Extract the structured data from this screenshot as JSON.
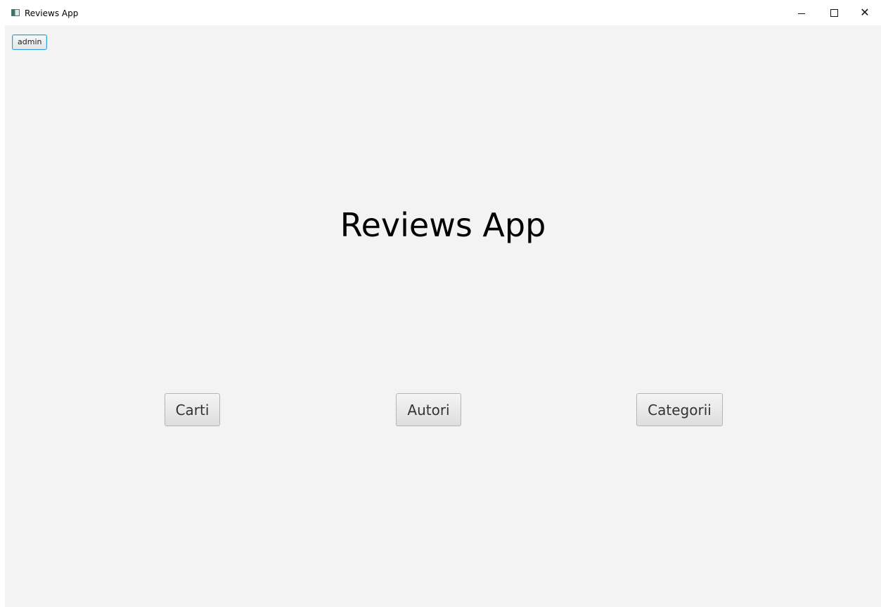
{
  "window": {
    "title": "Reviews App",
    "controls": {
      "minimize_glyph": "–",
      "maximize_glyph": "□",
      "close_glyph": "✕"
    }
  },
  "header": {
    "user_label": "admin"
  },
  "main": {
    "title": "Reviews App",
    "buttons": [
      {
        "label": "Carti"
      },
      {
        "label": "Autori"
      },
      {
        "label": "Categorii"
      }
    ]
  },
  "colors": {
    "background": "#f3f3f3",
    "focus_border": "#2aa0d8"
  }
}
